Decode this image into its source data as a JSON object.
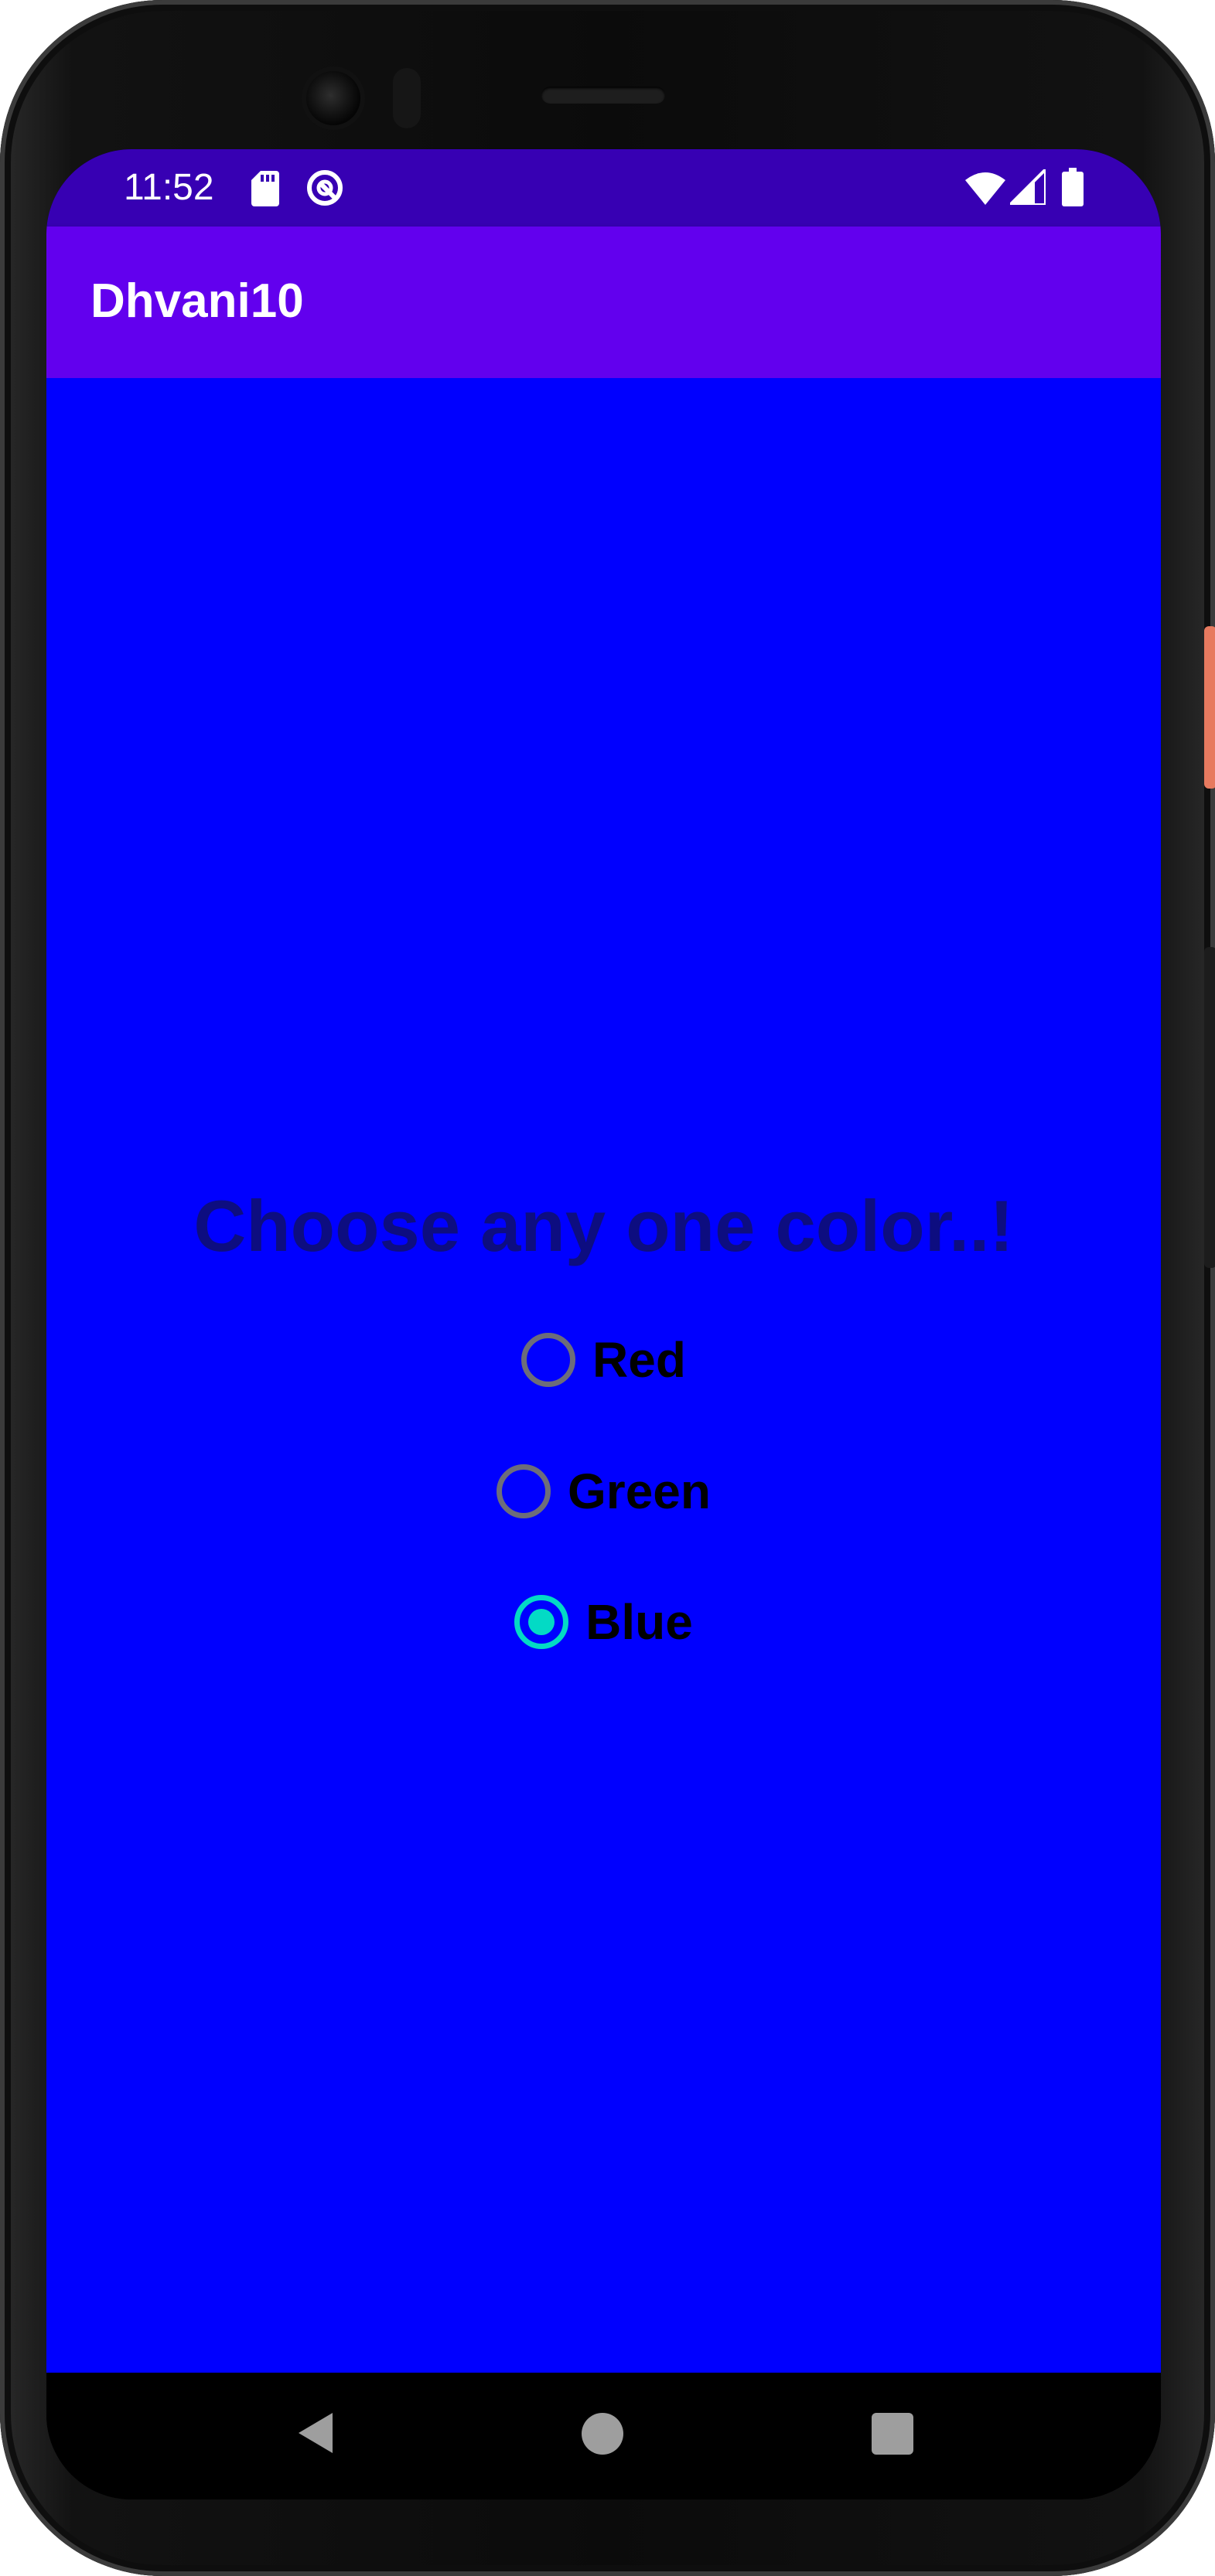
{
  "status_bar": {
    "time": "11:52",
    "icons": [
      "sd-card-icon",
      "sync-icon",
      "wifi-icon",
      "cell-signal-icon",
      "battery-icon"
    ]
  },
  "app_bar": {
    "title": "Dhvani10"
  },
  "main": {
    "heading": "Choose any one color..!",
    "radio_options": [
      {
        "label": "Red",
        "checked": false
      },
      {
        "label": "Green",
        "checked": false
      },
      {
        "label": "Blue",
        "checked": true
      }
    ]
  },
  "navigation_bar": {
    "icons": [
      "back-icon",
      "home-icon",
      "recents-icon"
    ]
  },
  "colors": {
    "status_bar": "#3700b3",
    "app_bar": "#6200ee",
    "background": "#0000ff",
    "heading_text": "#0d0d80",
    "radio_checked": "#03dac5",
    "radio_unchecked": "#6d6d7a"
  }
}
